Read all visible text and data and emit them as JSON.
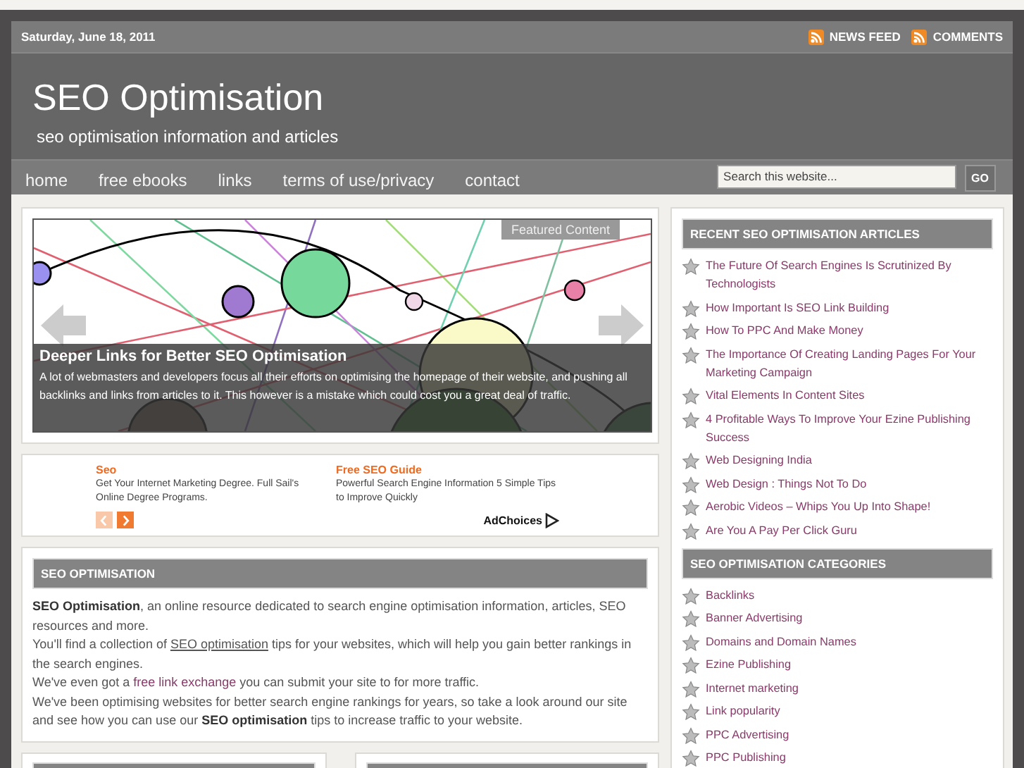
{
  "topbar": {
    "date": "Saturday, June 18, 2011",
    "feeds": [
      "NEWS FEED",
      "COMMENTS"
    ]
  },
  "header": {
    "title": "SEO Optimisation",
    "tagline": "seo optimisation information and articles"
  },
  "nav": {
    "items": [
      {
        "label": "home"
      },
      {
        "label": "free ebooks"
      },
      {
        "label": "links"
      },
      {
        "label": "terms of use/privacy"
      },
      {
        "label": "contact"
      }
    ],
    "search": {
      "placeholder": "Search this website...",
      "button": "GO"
    }
  },
  "featured": {
    "badge": "Featured Content",
    "title": "Deeper Links for Better SEO Optimisation",
    "text": "A lot of webmasters and developers focus all their efforts on optimising the homepage of their website, and pushing all backlinks and links from articles to it. This however is a mistake which could cost you a great deal of traffic."
  },
  "ads": {
    "items": [
      {
        "title": "Seo",
        "text": "Get Your Internet Marketing Degree. Full Sail's Online Degree Programs."
      },
      {
        "title": "Free SEO Guide",
        "text": "Powerful Search Engine Information 5 Simple Tips to Improve Quickly"
      }
    ],
    "pager": [
      {
        "kind": "prev",
        "disabled": true
      },
      {
        "kind": "next",
        "disabled": false
      }
    ],
    "adchoices": "AdChoices"
  },
  "about": {
    "heading": "SEO OPTIMISATION",
    "paragraphs": [
      [
        {
          "kind": "text",
          "text": "**SEO Optimisation**, an online resource dedicated to search engine optimisation information, articles, SEO resources and more."
        }
      ],
      [
        {
          "kind": "text",
          "text": "You'll find a collection of "
        },
        {
          "kind": "link",
          "text": "SEO optimisation",
          "underlined": true
        },
        {
          "kind": "text",
          "text": " tips for your websites, which will help you gain better rankings in the search engines."
        }
      ],
      [
        {
          "kind": "text",
          "text": "We've even got a "
        },
        {
          "kind": "link",
          "text": "free link exchange",
          "underlined": false
        },
        {
          "kind": "text",
          "text": " you can submit your site to for more traffic."
        }
      ],
      [
        {
          "kind": "text",
          "text": "We've been optimising websites for better search engine rankings for years, so take a look around our site and see how you can use our **SEO optimisation** tips to increase traffic to your website."
        }
      ]
    ]
  },
  "sidebar": {
    "widgets": [
      {
        "heading": "RECENT SEO OPTIMISATION ARTICLES",
        "items": [
          "The Future Of Search Engines Is Scrutinized By Technologists",
          "How Important Is SEO Link Building",
          "How To PPC And Make Money",
          "The Importance Of Creating Landing Pages For Your Marketing Campaign",
          "Vital Elements In Content Sites",
          "4 Profitable Ways To Improve Your Ezine Publishing Success",
          "Web Designing India",
          "Web Design : Things Not To Do",
          "Aerobic Videos – Whips You Up Into Shape!",
          "Are You A Pay Per Click Guru"
        ]
      },
      {
        "heading": "SEO OPTIMISATION CATEGORIES",
        "items": [
          "Backlinks",
          "Banner Advertising",
          "Domains and Domain Names",
          "Ezine Publishing",
          "Internet marketing",
          "Link popularity",
          "PPC Advertising",
          "PPC Publishing"
        ]
      }
    ]
  }
}
